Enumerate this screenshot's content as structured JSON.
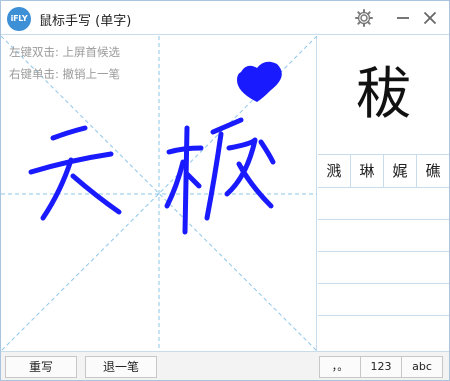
{
  "titlebar": {
    "logo_text": "iFLY",
    "title": "鼠标手写 (单字)",
    "settings_icon": "gear-icon",
    "minimize_icon": "minimize-icon",
    "close_icon": "close-icon"
  },
  "pad": {
    "hint_left_click": "左键双击: 上屏首候选",
    "hint_right_click": "右键单击: 撤销上一笔",
    "ink_color": "#1a1aff"
  },
  "candidates": {
    "primary": "秡",
    "alternatives": [
      "溅",
      "琳",
      "娓",
      "礁"
    ]
  },
  "bottombar": {
    "rewrite_label": "重写",
    "undo_label": "退一笔",
    "mode_punct": "，。",
    "mode_digits": "123",
    "mode_letters": "abc"
  },
  "colors": {
    "accent": "#3d8fd6",
    "guide": "#8ec7ea",
    "border": "#c9dcec"
  }
}
